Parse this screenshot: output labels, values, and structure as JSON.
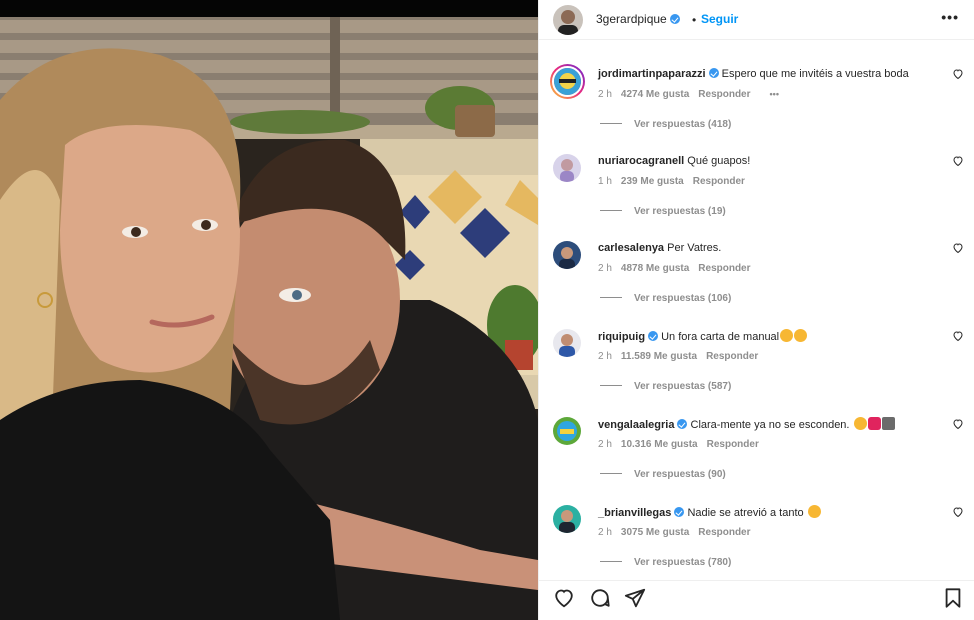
{
  "post": {
    "author": "3gerardpique",
    "separator": "•",
    "follow_label": "Seguir",
    "more_label": "•••"
  },
  "comments": [
    {
      "user": "jordimartinpaparazzi",
      "verified": true,
      "text": "Espero que me invitéis a vuestra boda",
      "time": "2 h",
      "likes": "4274 Me gusta",
      "reply": "Responder",
      "options": "•••",
      "replies": "Ver respuestas (418)"
    },
    {
      "user": "nuriarocagranell",
      "verified": false,
      "text": "Qué guapos!",
      "time": "1 h",
      "likes": "239 Me gusta",
      "reply": "Responder",
      "replies": "Ver respuestas (19)"
    },
    {
      "user": "carlesalenya",
      "verified": false,
      "text": "Per Vatres.",
      "time": "2 h",
      "likes": "4878 Me gusta",
      "reply": "Responder",
      "replies": "Ver respuestas (106)"
    },
    {
      "user": "riquipuig",
      "verified": true,
      "text": "Un fora carta de manual",
      "time": "2 h",
      "likes": "11.589 Me gusta",
      "reply": "Responder",
      "replies": "Ver respuestas (587)"
    },
    {
      "user": "vengalaalegria",
      "verified": true,
      "text": "Clara-mente ya no se esconden.",
      "time": "2 h",
      "likes": "10.316 Me gusta",
      "reply": "Responder",
      "replies": "Ver respuestas (90)"
    },
    {
      "user": "_brianvillegas",
      "verified": true,
      "text": "Nadie se atrevió a tanto",
      "time": "2 h",
      "likes": "3075 Me gusta",
      "reply": "Responder",
      "replies": "Ver respuestas (780)"
    }
  ],
  "actions": {
    "like": "heart-icon",
    "comment": "comment-icon",
    "share": "paper-plane-icon",
    "save": "bookmark-icon"
  },
  "colors": {
    "accent": "#0095f6",
    "verified": "#3897f0",
    "meta": "#8e8e8e",
    "text": "#262626"
  }
}
